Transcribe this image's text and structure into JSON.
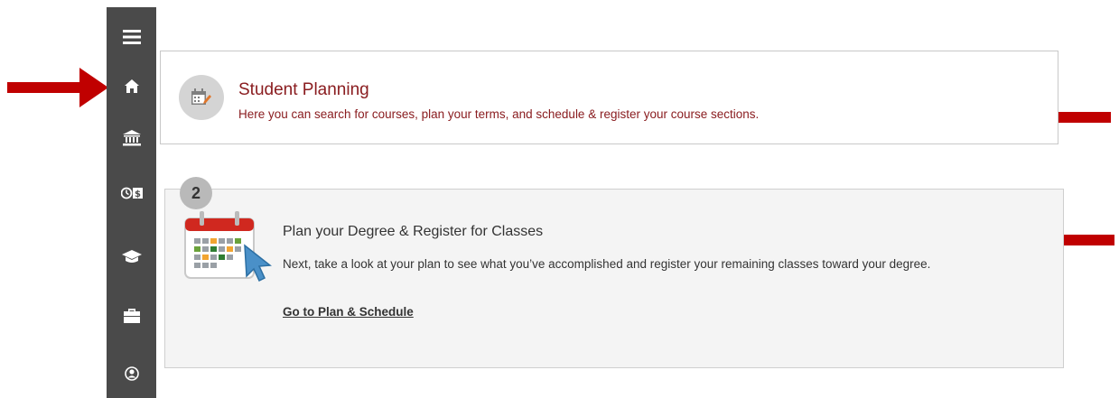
{
  "sidebar": {
    "items": [
      {
        "icon": "menu-icon"
      },
      {
        "icon": "home-icon"
      },
      {
        "icon": "bank-icon"
      },
      {
        "icon": "financial-clock-icon"
      },
      {
        "icon": "graduation-cap-icon"
      },
      {
        "icon": "briefcase-icon"
      },
      {
        "icon": "user-circle-icon"
      }
    ]
  },
  "student_planning": {
    "title": "Student Planning",
    "description": "Here you can search for courses, plan your terms, and schedule & register your course sections.",
    "icon": "planner-icon"
  },
  "step": {
    "number": "2",
    "title": "Plan your Degree & Register for Classes",
    "description": "Next, take a look at your plan to see what you’ve accomplished and register your remaining classes toward your degree.",
    "link": "Go to Plan & Schedule",
    "icon": "calendar-cursor-icon"
  },
  "colors": {
    "sidebar": "#4a4a4a",
    "accent_red": "#8a1d20",
    "annotation_arrow": "#c00000",
    "card_bg": "#f4f4f4"
  }
}
